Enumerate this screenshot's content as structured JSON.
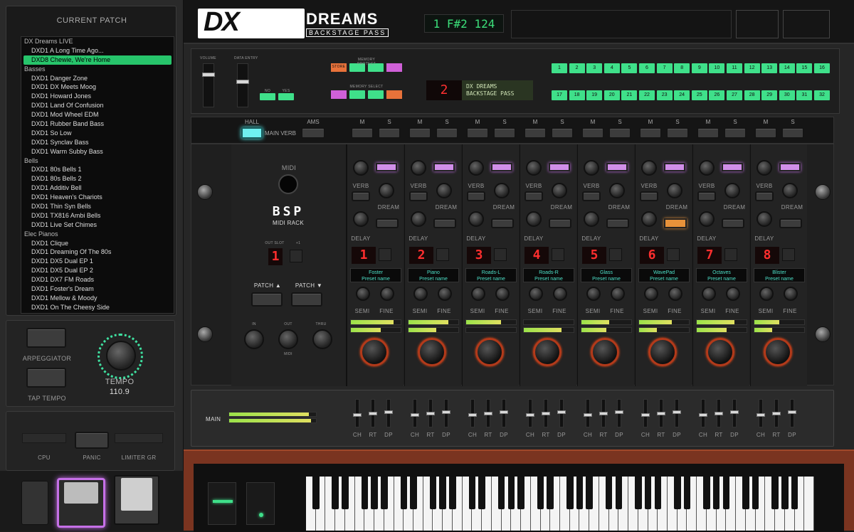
{
  "sidebar": {
    "current_patch_title": "CURRENT PATCH",
    "patches": [
      {
        "label": "DX Dreams LIVE",
        "type": "category"
      },
      {
        "label": "DXD1 A Long Time Ago...",
        "type": "item"
      },
      {
        "label": "DXD8 Chewie, We're Home",
        "type": "selected"
      },
      {
        "label": "Basses",
        "type": "category"
      },
      {
        "label": "DXD1 Danger Zone",
        "type": "item"
      },
      {
        "label": "DXD1 DX Meets Moog",
        "type": "item"
      },
      {
        "label": "DXD1 Howard Jones",
        "type": "item"
      },
      {
        "label": "DXD1 Land Of Confusion",
        "type": "item"
      },
      {
        "label": "DXD1 Mod Wheel EDM",
        "type": "item"
      },
      {
        "label": "DXD1 Rubber Band Bass",
        "type": "item"
      },
      {
        "label": "DXD1 So Low",
        "type": "item"
      },
      {
        "label": "DXD1 Synclav Bass",
        "type": "item"
      },
      {
        "label": "DXD1 Warm Subby Bass",
        "type": "item"
      },
      {
        "label": "Bells",
        "type": "category"
      },
      {
        "label": "DXD1 80s Bells 1",
        "type": "item"
      },
      {
        "label": "DXD1 80s Bells 2",
        "type": "item"
      },
      {
        "label": "DXD1 Additiv Bell",
        "type": "item"
      },
      {
        "label": "DXD1 Heaven's Chariots",
        "type": "item"
      },
      {
        "label": "DXD1 Thin Syn Bells",
        "type": "item"
      },
      {
        "label": "DXD1 TX816 Ambi Bells",
        "type": "item"
      },
      {
        "label": "DXD1 Live Set Chimes",
        "type": "item"
      },
      {
        "label": "Elec Pianos",
        "type": "category"
      },
      {
        "label": "DXD1 Clique",
        "type": "item"
      },
      {
        "label": "DXD1 Dreaming Of The 80s",
        "type": "item"
      },
      {
        "label": "DXD1 DX5 Dual EP 1",
        "type": "item"
      },
      {
        "label": "DXD1 DX5 Dual EP 2",
        "type": "item"
      },
      {
        "label": "DXD1 DX7 FM Roads",
        "type": "item"
      },
      {
        "label": "DXD1 Foster's Dream",
        "type": "item"
      },
      {
        "label": "DXD1 Mellow & Moody",
        "type": "item"
      },
      {
        "label": "DXD1 On The Cheesy Side",
        "type": "item"
      }
    ],
    "arpeggiator_label": "ARPEGGIATOR",
    "tap_tempo_label": "TAP TEMPO",
    "tempo_label": "TEMPO",
    "tempo_value": "110.9",
    "cpu_label": "CPU",
    "panic_label": "PANIC",
    "limiter_label": "LIMITER GR"
  },
  "header": {
    "logo": "DX",
    "brand": "DREAMS",
    "subbrand": "BACKSTAGE PASS",
    "display": "1 F#2 124"
  },
  "synth_panel": {
    "volume_label": "VOLUME",
    "data_label": "DATA ENTRY",
    "no_label": "NO",
    "yes_label": "YES",
    "store_label": "STORE",
    "memory_protect_label": "MEMORY PROTECT",
    "internal_label": "INTERNAL",
    "cartridge_label": "CARTRIDGE",
    "operator_select_label": "OPERATOR SELECT",
    "edit_label": "EDIT",
    "memory_select_label": "MEMORY SELECT",
    "function_label": "FUNCTION",
    "lcd_number": "2",
    "lcd_line1": "DX DREAMS",
    "lcd_line2": "BACKSTAGE PASS",
    "numbers_row1": [
      "1",
      "2",
      "3",
      "4",
      "5",
      "6",
      "7",
      "8",
      "9",
      "10",
      "11",
      "12",
      "13",
      "14",
      "15",
      "16"
    ],
    "numbers_row2": [
      "17",
      "18",
      "19",
      "20",
      "21",
      "22",
      "23",
      "24",
      "25",
      "26",
      "27",
      "28",
      "29",
      "30",
      "31",
      "32"
    ]
  },
  "strip": {
    "hall_label": "HALL",
    "main_verb_label": "MAIN VERB",
    "ams_label": "AMS",
    "m_label": "M",
    "s_label": "S"
  },
  "rack": {
    "midi_label": "MIDI",
    "bsp_label": "BSP",
    "midi_rack_label": "MIDI RACK",
    "out_slot_label": "OUT SLOT",
    "plus1_label": "+1",
    "out_slot_value": "1",
    "patch_up": "PATCH ▲",
    "patch_down": "PATCH ▼",
    "in_label": "IN",
    "out_label": "OUT",
    "thru_label": "THRU",
    "midi_small": "MIDI",
    "verb_label": "VERB",
    "dream_label": "DREAM",
    "delay_label": "DELAY",
    "semi_label": "SEMI",
    "fine_label": "FINE",
    "preset_label": "Preset name",
    "channels": [
      {
        "num": "1",
        "name": "Foster",
        "level1": 0.85,
        "level2": 0.6
      },
      {
        "num": "2",
        "name": "Piano",
        "level1": 0.8,
        "level2": 0.55
      },
      {
        "num": "3",
        "name": "Roads-L",
        "level1": 0.7,
        "level2": 0
      },
      {
        "num": "4",
        "name": "Roads-R",
        "level1": 0,
        "level2": 0.75
      },
      {
        "num": "5",
        "name": "Glass",
        "level1": 0.55,
        "level2": 0.5
      },
      {
        "num": "6",
        "name": "WavePad",
        "level1": 0.65,
        "level2": 0.35
      },
      {
        "num": "7",
        "name": "Octaves",
        "level1": 0.75,
        "level2": 0.6
      },
      {
        "num": "8",
        "name": "Blister",
        "level1": 0.5,
        "level2": 0.35
      }
    ]
  },
  "mixer": {
    "main_label": "MAIN",
    "main_level1": 0.92,
    "main_level2": 0.94,
    "ch_label": "CH",
    "rt_label": "RT",
    "dp_label": "DP"
  }
}
